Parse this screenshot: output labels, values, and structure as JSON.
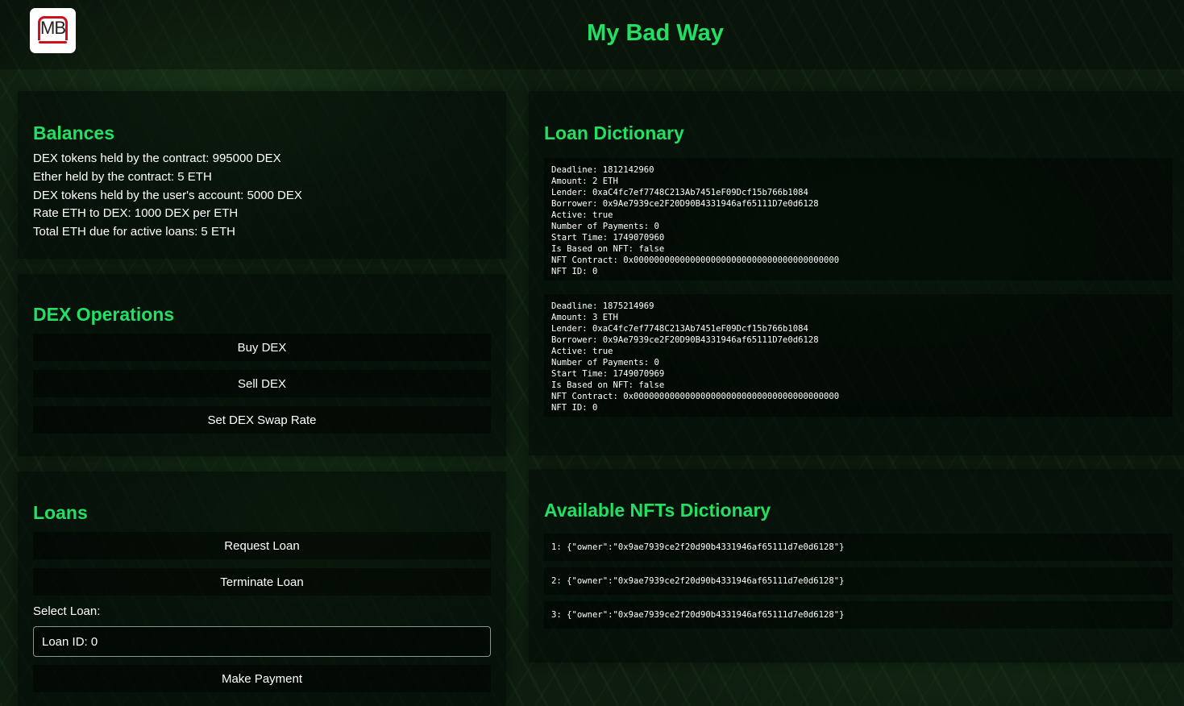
{
  "header": {
    "logo_text": "MB",
    "title": "My Bad Way"
  },
  "balances": {
    "title": "Balances",
    "lines": [
      "DEX tokens held by the contract: 995000 DEX",
      "Ether held by the contract: 5 ETH",
      "DEX tokens held by the user's account: 5000 DEX",
      "Rate ETH to DEX: 1000 DEX per ETH",
      "Total ETH due for active loans: 5 ETH"
    ]
  },
  "dex_operations": {
    "title": "DEX Operations",
    "buttons": [
      "Buy DEX",
      "Sell DEX",
      "Set DEX Swap Rate"
    ]
  },
  "loans": {
    "title": "Loans",
    "request_label": "Request Loan",
    "terminate_label": "Terminate Loan",
    "select_label": "Select Loan:",
    "select_value": "Loan ID: 0",
    "payment_label": "Make Payment"
  },
  "loan_dictionary": {
    "title": "Loan Dictionary",
    "entries": [
      [
        "Deadline: 1812142960",
        "Amount: 2 ETH",
        "Lender: 0xaC4fc7ef7748C213Ab7451eF09Dcf15b766b1084",
        "Borrower: 0x9Ae7939ce2F20D90B4331946af65111D7e0d6128",
        "Active: true",
        "Number of Payments: 0",
        "Start Time: 1749070960",
        "Is Based on NFT: false",
        "NFT Contract: 0x0000000000000000000000000000000000000000",
        "NFT ID: 0"
      ],
      [
        "Deadline: 1875214969",
        "Amount: 3 ETH",
        "Lender: 0xaC4fc7ef7748C213Ab7451eF09Dcf15b766b1084",
        "Borrower: 0x9Ae7939ce2F20D90B4331946af65111D7e0d6128",
        "Active: true",
        "Number of Payments: 0",
        "Start Time: 1749070969",
        "Is Based on NFT: false",
        "NFT Contract: 0x0000000000000000000000000000000000000000",
        "NFT ID: 0"
      ]
    ]
  },
  "nft_dictionary": {
    "title": "Available NFTs Dictionary",
    "entries": [
      "1: {\"owner\":\"0x9ae7939ce2f20d90b4331946af65111d7e0d6128\"}",
      "2: {\"owner\":\"0x9ae7939ce2f20d90b4331946af65111d7e0d6128\"}",
      "3: {\"owner\":\"0x9ae7939ce2f20d90b4331946af65111d7e0d6128\"}"
    ]
  },
  "colors": {
    "accent": "#21e063",
    "logo_red": "#d0111d"
  }
}
